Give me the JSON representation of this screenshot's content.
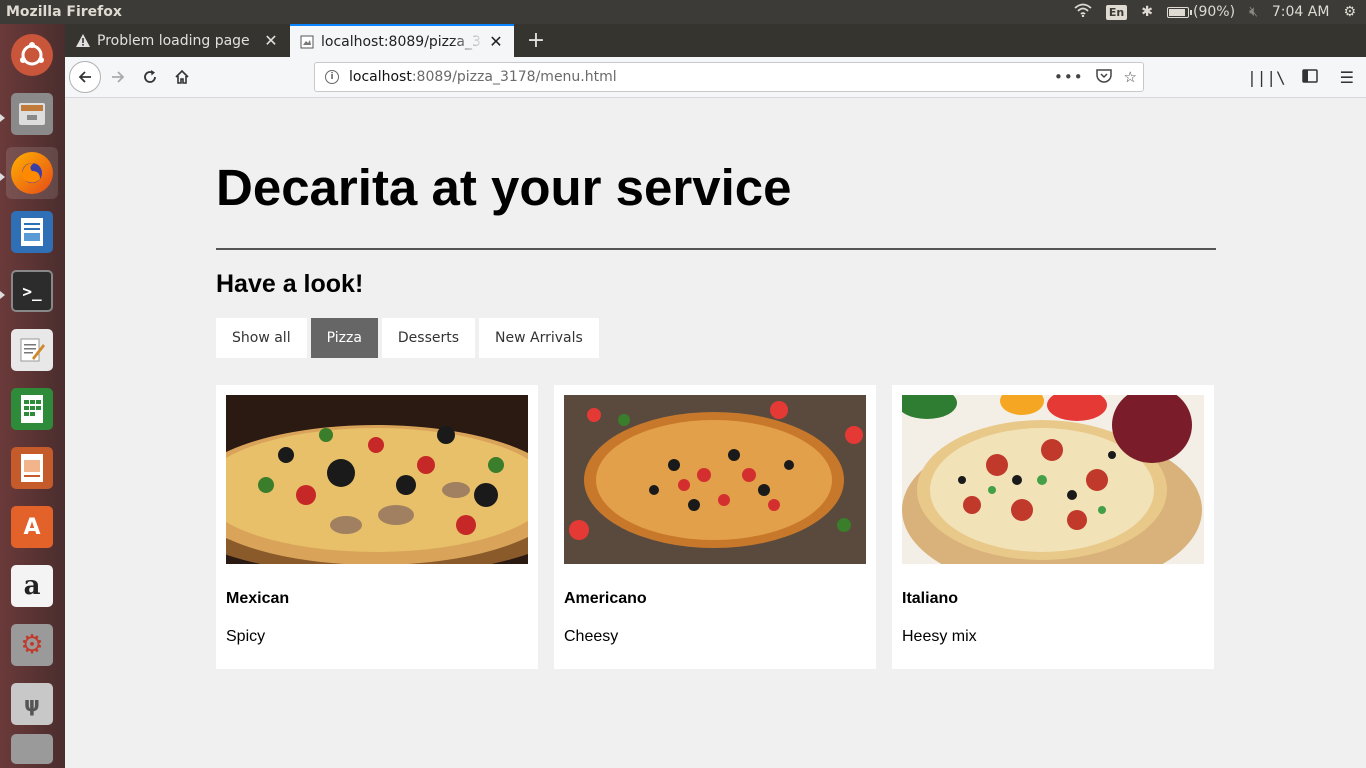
{
  "system": {
    "app_title": "Mozilla Firefox",
    "keyboard": "En",
    "battery": "(90%)",
    "battery_level": 0.9,
    "time": "7:04 AM"
  },
  "tabs": [
    {
      "title": "Problem loading page",
      "icon": "warning-icon"
    },
    {
      "title": "localhost:8089/pizza_3178",
      "icon": "page-icon"
    }
  ],
  "urlbar": {
    "host": "localhost",
    "rest": ":8089/pizza_3178/menu.html"
  },
  "page": {
    "title": "Decarita at your service",
    "subtitle": "Have a look!",
    "filters": [
      {
        "label": "Show all",
        "active": false
      },
      {
        "label": "Pizza",
        "active": true
      },
      {
        "label": "Desserts",
        "active": false
      },
      {
        "label": "New Arrivals",
        "active": false
      }
    ],
    "items": [
      {
        "name": "Mexican",
        "desc": "Spicy"
      },
      {
        "name": "Americano",
        "desc": "Cheesy"
      },
      {
        "name": "Italiano",
        "desc": "Heesy mix"
      }
    ]
  },
  "colors": {
    "page_bg": "#f0f0f0",
    "active_filter": "#666666",
    "panel": "#3c3b37",
    "launcher": "#5a3333"
  }
}
